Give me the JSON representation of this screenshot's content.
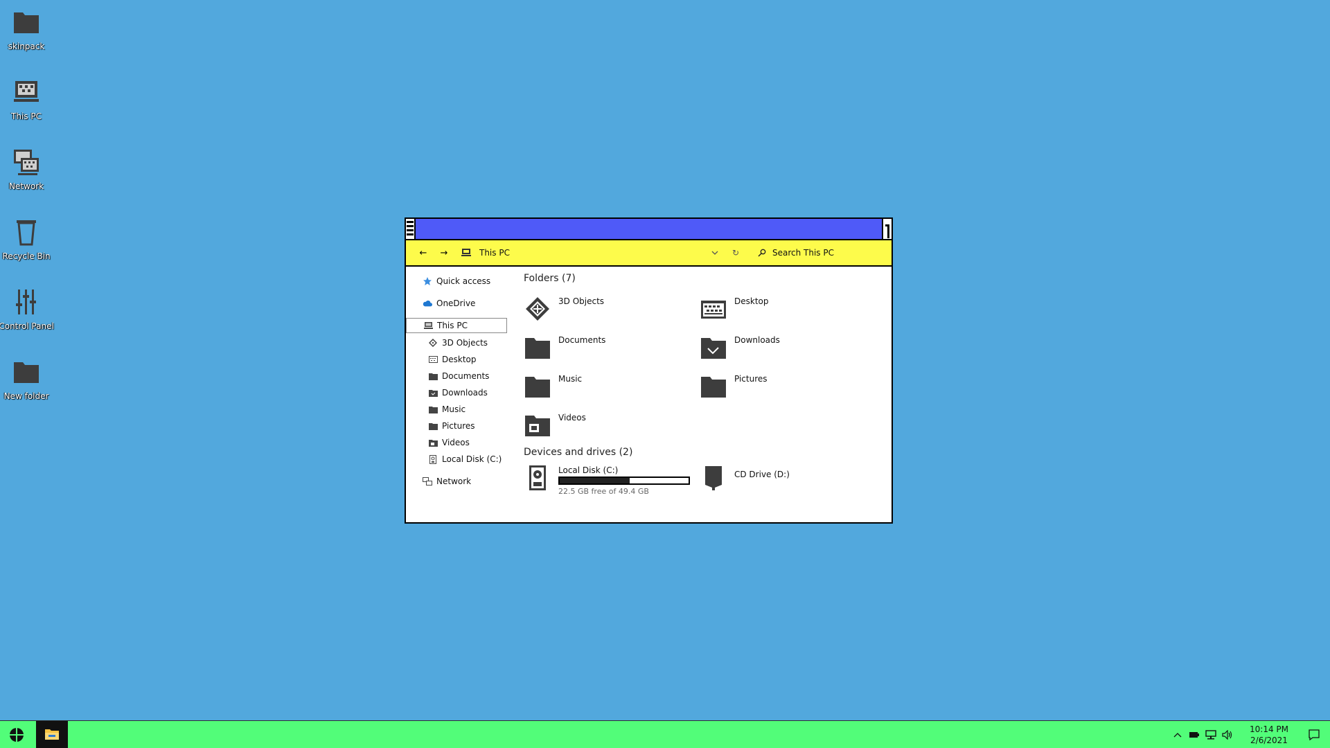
{
  "desktop": {
    "icons": [
      {
        "label": "skinpack",
        "icon": "folder-icon"
      },
      {
        "label": "This PC",
        "icon": "computer-icon"
      },
      {
        "label": "Network",
        "icon": "network-icon"
      },
      {
        "label": "Recycle Bin",
        "icon": "recycle-bin-icon"
      },
      {
        "label": "Control Panel",
        "icon": "control-panel-icon"
      },
      {
        "label": "New folder",
        "icon": "folder-icon"
      }
    ]
  },
  "explorer": {
    "titlebar_color": "#4f5af8",
    "toolbar_color": "#fdfb4b",
    "address": "This PC",
    "search_placeholder": "Search This PC",
    "nav": {
      "quick_access": "Quick access",
      "onedrive": "OneDrive",
      "this_pc": "This PC",
      "children": [
        "3D Objects",
        "Desktop",
        "Documents",
        "Downloads",
        "Music",
        "Pictures",
        "Videos",
        "Local Disk (C:)"
      ],
      "network": "Network"
    },
    "folders_title": "Folders (7)",
    "folders": [
      "3D Objects",
      "Desktop",
      "Documents",
      "Downloads",
      "Music",
      "Pictures",
      "Videos"
    ],
    "devices_title": "Devices and drives (2)",
    "drives": {
      "c_label": "Local Disk (C:)",
      "c_free": "22.5 GB free of 49.4 GB",
      "c_used_fraction": 0.545,
      "d_label": "CD Drive (D:)"
    }
  },
  "taskbar": {
    "color": "#52fd79",
    "time": "10:14 PM",
    "date": "2/6/2021"
  }
}
